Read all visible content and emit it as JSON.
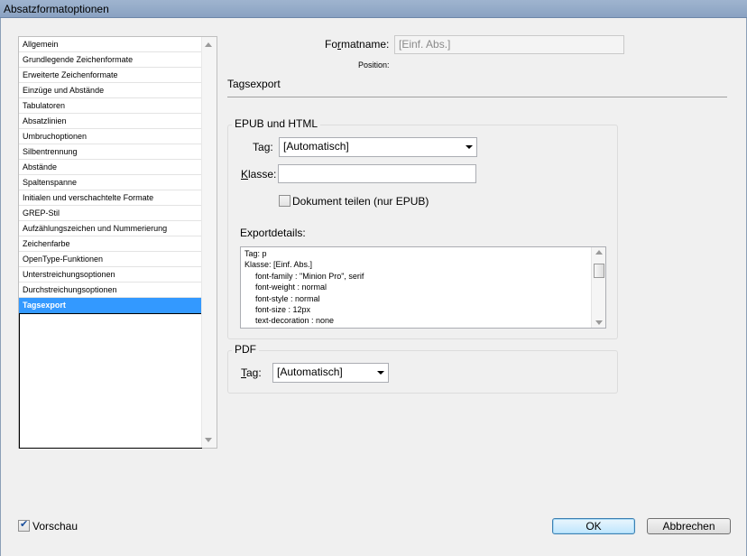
{
  "window": {
    "title": "Absatzformatoptionen"
  },
  "sidebar": {
    "items": [
      {
        "label": "Allgemein"
      },
      {
        "label": "Grundlegende Zeichenformate"
      },
      {
        "label": "Erweiterte Zeichenformate"
      },
      {
        "label": "Einzüge und Abstände"
      },
      {
        "label": "Tabulatoren"
      },
      {
        "label": "Absatzlinien"
      },
      {
        "label": "Umbruchoptionen"
      },
      {
        "label": "Silbentrennung"
      },
      {
        "label": "Abstände"
      },
      {
        "label": "Spaltenspanne"
      },
      {
        "label": "Initialen und verschachtelte Formate"
      },
      {
        "label": "GREP-Stil"
      },
      {
        "label": "Aufzählungszeichen und Nummerierung"
      },
      {
        "label": "Zeichenfarbe"
      },
      {
        "label": "OpenType-Funktionen"
      },
      {
        "label": "Unterstreichungsoptionen"
      },
      {
        "label": "Durchstreichungsoptionen"
      },
      {
        "label": "Tagsexport",
        "selected": true
      }
    ]
  },
  "header": {
    "format_name_label_pre": "Fo",
    "format_name_label_u": "r",
    "format_name_label_post": "matname:",
    "format_name_value": "[Einf. Abs.]",
    "position_label": "Position:",
    "section_title": "Tagsexport"
  },
  "epub": {
    "group_title": "EPUB und HTML",
    "tag_label_pre": "Ta",
    "tag_label_u": "g",
    "tag_label_post": ":",
    "tag_value": "[Automatisch]",
    "class_label_u": "K",
    "class_label_post": "lasse:",
    "class_value": "",
    "split_label": "Dokument teilen (nur EPUB)",
    "split_checked": false,
    "export_details_label": "Exportdetails:",
    "export_details_lines": [
      {
        "text": "Tag: p",
        "indent": false
      },
      {
        "text": "Klasse: [Einf. Abs.]",
        "indent": false
      },
      {
        "text": "font-family : \"Minion Pro\", serif",
        "indent": true
      },
      {
        "text": "font-weight : normal",
        "indent": true
      },
      {
        "text": "font-style : normal",
        "indent": true
      },
      {
        "text": "font-size : 12px",
        "indent": true
      },
      {
        "text": "text-decoration : none",
        "indent": true
      }
    ]
  },
  "pdf": {
    "group_title": "PDF",
    "tag_label_u": "T",
    "tag_label_post": "ag:",
    "tag_value": "[Automatisch]"
  },
  "footer": {
    "preview_label": "Vorschau",
    "preview_checked": true,
    "ok_label": "OK",
    "cancel_label": "Abbrechen"
  }
}
